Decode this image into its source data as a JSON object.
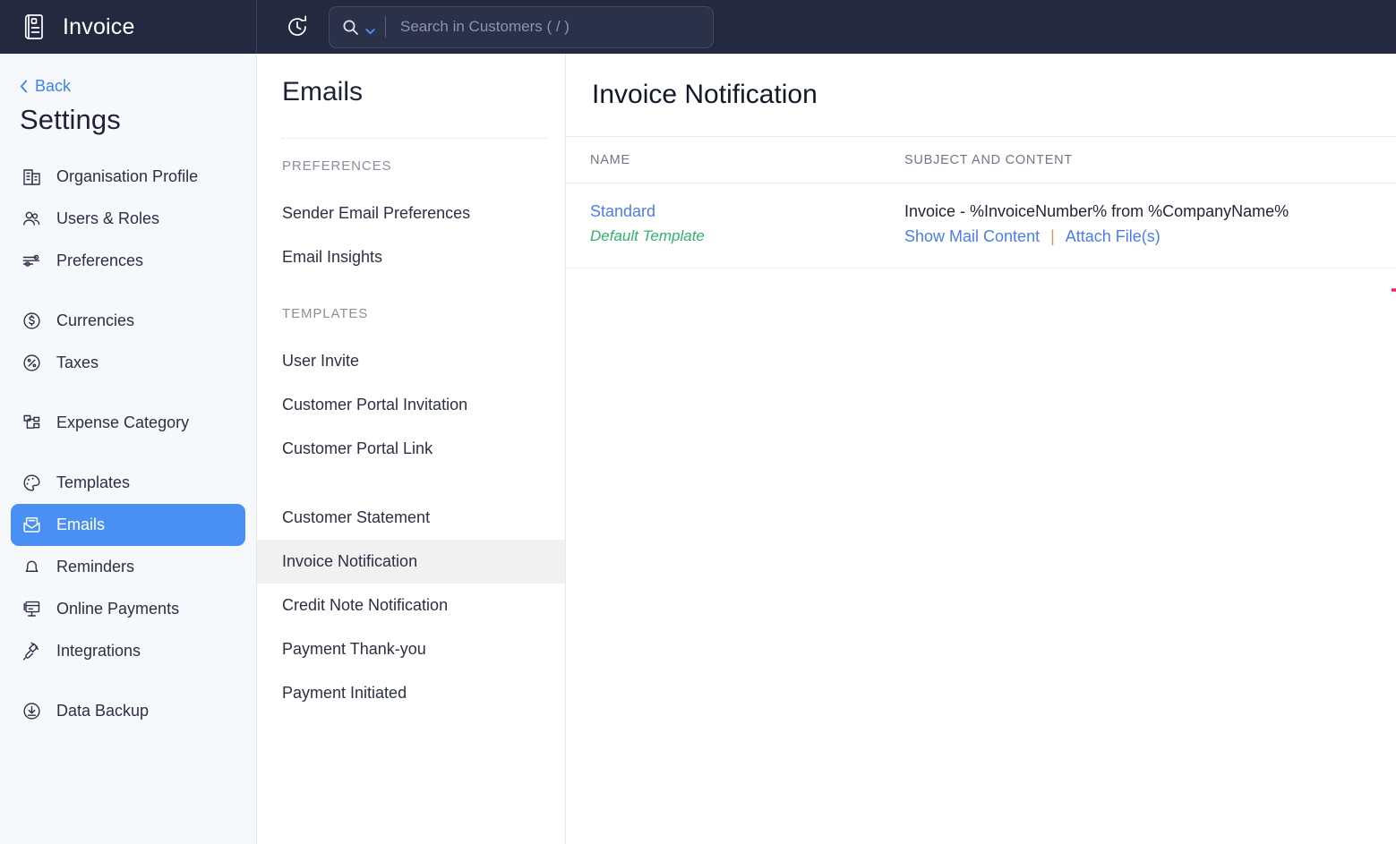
{
  "topbar": {
    "brand": "Invoice",
    "brand_icon": "invoice-document-icon",
    "refresh_icon": "refresh-clock-icon",
    "search": {
      "icon": "search-icon",
      "dropdown_icon": "chevron-down-icon",
      "placeholder": "Search in Customers ( / )",
      "value": ""
    },
    "bg_color": "#242940"
  },
  "sidebar": {
    "back_label": "Back",
    "back_icon": "chevron-left-icon",
    "title": "Settings",
    "active_item": "Emails",
    "accent_color": "#4a90f4",
    "bg_color": "#f7f8fb",
    "groups": [
      {
        "items": [
          {
            "label": "Organisation Profile",
            "icon": "building-icon"
          },
          {
            "label": "Users & Roles",
            "icon": "users-icon"
          },
          {
            "label": "Preferences",
            "icon": "sliders-icon"
          }
        ]
      },
      {
        "items": [
          {
            "label": "Currencies",
            "icon": "dollar-circle-icon"
          },
          {
            "label": "Taxes",
            "icon": "percent-circle-icon"
          }
        ]
      },
      {
        "items": [
          {
            "label": "Expense Category",
            "icon": "hierarchy-icon"
          }
        ]
      },
      {
        "items": [
          {
            "label": "Templates",
            "icon": "palette-icon"
          },
          {
            "label": "Emails",
            "icon": "envelope-open-icon"
          },
          {
            "label": "Reminders",
            "icon": "bell-icon"
          },
          {
            "label": "Online Payments",
            "icon": "card-terminal-icon"
          },
          {
            "label": "Integrations",
            "icon": "plug-icon"
          }
        ]
      },
      {
        "items": [
          {
            "label": "Data Backup",
            "icon": "download-circle-icon"
          }
        ]
      }
    ]
  },
  "midpanel": {
    "title": "Emails",
    "selected_item": "Invoice Notification",
    "sections": [
      {
        "label": "PREFERENCES",
        "items": [
          "Sender Email Preferences",
          "Email Insights"
        ]
      },
      {
        "label": "TEMPLATES",
        "items": [
          "User Invite",
          "Customer Portal Invitation",
          "Customer Portal Link"
        ]
      },
      {
        "label": "",
        "items": [
          "Customer Statement",
          "Invoice Notification",
          "Credit Note Notification",
          "Payment Thank-you",
          "Payment Initiated"
        ]
      }
    ]
  },
  "main": {
    "title": "Invoice Notification",
    "table": {
      "columns": [
        "NAME",
        "SUBJECT AND CONTENT"
      ],
      "rows": [
        {
          "name": "Standard",
          "name_sub": "Default Template",
          "subject": "Invoice - %InvoiceNumber% from %CompanyName%",
          "actions": [
            {
              "label": "Show Mail Content"
            },
            {
              "label": "Attach File(s)"
            }
          ],
          "action_separator": "|"
        }
      ]
    },
    "annotation": {
      "type": "arrow",
      "color": "#f5206a",
      "points_to": "Show Mail Content"
    }
  }
}
